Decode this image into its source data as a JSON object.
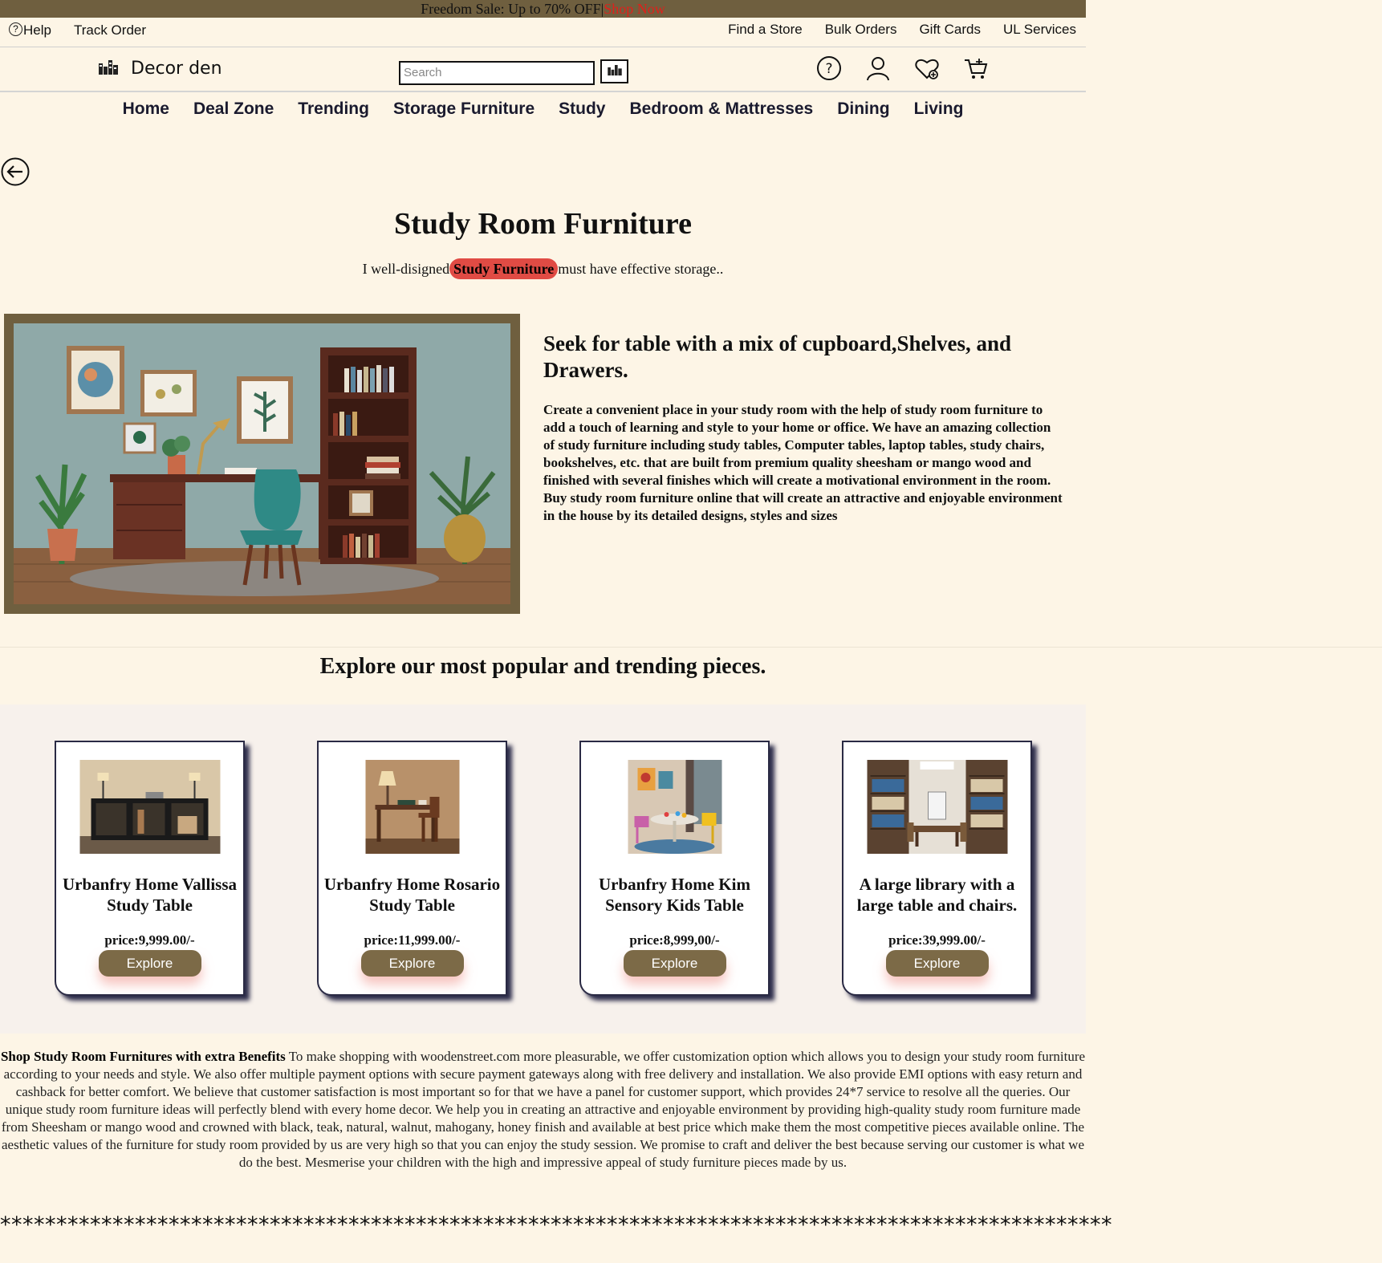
{
  "sale_bar": {
    "text": "Freedom Sale: Up to 70% OFF|",
    "cta": "Shop Now"
  },
  "util": {
    "help": "Help",
    "track": "Track Order",
    "right": [
      "Find a Store",
      "Bulk Orders",
      "Gift Cards",
      "UL Services"
    ]
  },
  "header": {
    "brand": "Decor den",
    "search_placeholder": "Search"
  },
  "nav": [
    "Home",
    "Deal Zone",
    "Trending",
    "Storage Furniture",
    "Study",
    "Bedroom & Mattresses",
    "Dining",
    "Living"
  ],
  "page": {
    "title": "Study Room Furniture",
    "sub_before": "I well-disigned",
    "sub_highlight": "Study Furniture",
    "sub_after": "must have effective storage.."
  },
  "hero": {
    "heading": "Seek for table with a mix of cupboard,Shelves, and Drawers.",
    "body": "Create a convenient place in your study room with the help of study room furniture to add a touch of learning and style to your home or office. We have an amazing collection of study furniture including study tables, Computer tables, laptop tables, study chairs, bookshelves, etc. that are built from premium quality sheesham or mango wood and finished with several finishes which will create a motivational environment in the room. Buy study room furniture online that will create an attractive and enjoyable environment in the house by its detailed designs, styles and sizes"
  },
  "explore_title": "Explore our most popular and trending pieces.",
  "products": [
    {
      "name": "Urbanfry Home Vallissa Study Table",
      "price": "price:9,999.00/-",
      "button": "Explore"
    },
    {
      "name": "Urbanfry Home Rosario Study Table",
      "price": "price:11,999.00/-",
      "button": "Explore"
    },
    {
      "name": "Urbanfry Home Kim Sensory Kids Table",
      "price": "price:8,999,00/-",
      "button": "Explore"
    },
    {
      "name": "A large library with a large table and chairs.",
      "price": "price:39,999.00/-",
      "button": "Explore"
    }
  ],
  "benefits": {
    "lead": "Shop Study Room Furnitures with extra Benefits",
    "body": " To make shopping with woodenstreet.com more pleasurable, we offer customization option which allows you to design your study room furniture according to your needs and style. We also offer multiple payment options with secure payment gateways along with free delivery and installation. We also provide EMI options with easy return and cashback for better comfort. We believe that customer satisfaction is most important so for that we have a panel for customer support, which provides 24*7 service to resolve all the queries. Our unique study room furniture ideas will perfectly blend with every home decor. We help you in creating an attractive and enjoyable environment by providing high-quality study room furniture made from Sheesham or mango wood and crowned with black, teak, natural, walnut, mahogany, honey finish and available at best price which make them the most competitive pieces available online. The aesthetic values of the furniture for study room provided by us are very high so that you can enjoy the study session. We promise to craft and deliver the best because serving our customer is what we do the best. Mesmerise your children with the high and impressive appeal of study furniture pieces made by us."
  },
  "stars": "***************************************************************************************************",
  "colors": {
    "sale_bar": "#6f5f3f",
    "accent_red": "#e04b44",
    "button": "#7c6a47",
    "background": "#fdf5e6"
  }
}
